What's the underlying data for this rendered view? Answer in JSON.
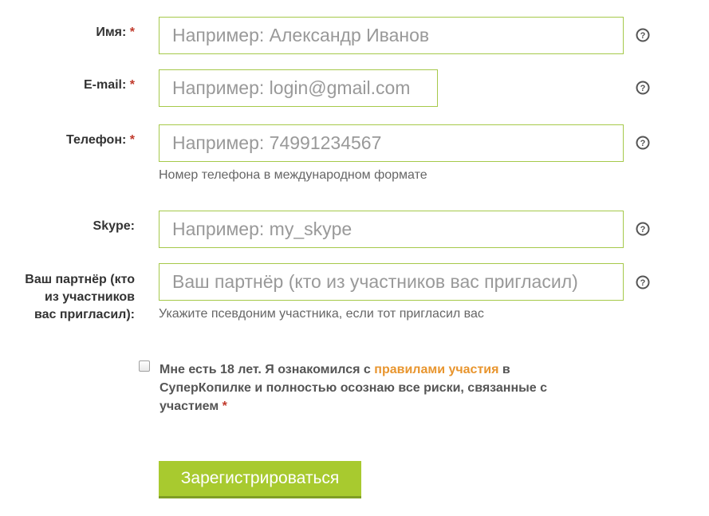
{
  "fields": {
    "name": {
      "label": "Имя:",
      "required_mark": "*",
      "placeholder": "Например: Александр Иванов",
      "value": ""
    },
    "email": {
      "label": "E-mail:",
      "required_mark": "*",
      "placeholder": "Например: login@gmail.com",
      "value": ""
    },
    "phone": {
      "label": "Телефон:",
      "required_mark": "*",
      "placeholder": "Например: 74991234567",
      "value": "",
      "hint": "Номер телефона в международном формате"
    },
    "skype": {
      "label": "Skype:",
      "placeholder": "Например: my_skype",
      "value": ""
    },
    "partner": {
      "label_lines": [
        "Ваш партнёр (кто",
        "из участников",
        "вас пригласил):"
      ],
      "placeholder": "Ваш партнёр (кто из участников вас пригласил)",
      "value": "",
      "hint": "Укажите псевдоним участника, если тот пригласил вас"
    }
  },
  "agreement": {
    "checked": false,
    "text_before": "Мне есть 18 лет. Я ознакомился с ",
    "link_text": "правилами участия",
    "text_line1_after": " в",
    "text_line2": "СуперКопилке и полностью осознаю все риски, связанные с",
    "text_line3": "участием ",
    "required_mark": "*"
  },
  "submit_label": "Зарегистрироваться",
  "colors": {
    "accent": "#a8ca2f",
    "input_border": "#a6c94a",
    "link": "#e8952e",
    "required": "#c0392b"
  },
  "icons": {
    "help": "question-circle-icon"
  }
}
